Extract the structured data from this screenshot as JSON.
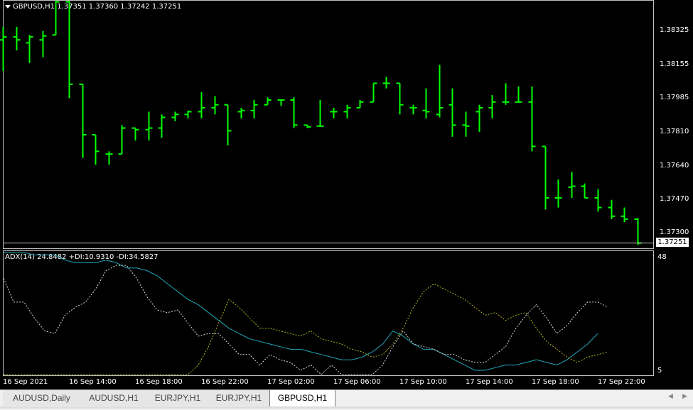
{
  "chart": {
    "symbol_title": "GBPUSD,H1  1.37351 1.37360 1.37242 1.37251",
    "current_price": "1.37251",
    "price_axis": [
      "1.38325",
      "1.38155",
      "1.37985",
      "1.37810",
      "1.37640",
      "1.37470",
      "1.37300"
    ],
    "bar_color": "#00ff00",
    "bars": [
      [
        1.38281,
        1.38347,
        1.38123,
        1.38296
      ],
      [
        1.38296,
        1.38347,
        1.38228,
        1.38281
      ],
      [
        1.38266,
        1.38306,
        1.38164,
        1.38296
      ],
      [
        1.38281,
        1.38326,
        1.38193,
        1.38301
      ],
      [
        1.38306,
        1.38479,
        1.38306,
        1.38474
      ],
      [
        1.38474,
        1.38479,
        1.37985,
        1.38056
      ],
      [
        1.38056,
        1.38056,
        1.37682,
        1.378
      ],
      [
        1.378,
        1.378,
        1.37648,
        1.37716
      ],
      [
        1.37702,
        1.37716,
        1.37648,
        1.37702
      ],
      [
        1.37702,
        1.37849,
        1.37702,
        1.37834
      ],
      [
        1.37834,
        1.37834,
        1.37771,
        1.37826
      ],
      [
        1.37826,
        1.37917,
        1.37771,
        1.37834
      ],
      [
        1.37834,
        1.37903,
        1.37785,
        1.37888
      ],
      [
        1.37888,
        1.37917,
        1.37869,
        1.37903
      ],
      [
        1.37903,
        1.37923,
        1.37883,
        1.37917
      ],
      [
        1.37917,
        1.38016,
        1.37883,
        1.37937
      ],
      [
        1.37937,
        1.37996,
        1.37903,
        1.37952
      ],
      [
        1.37952,
        1.37952,
        1.37746,
        1.3782
      ],
      [
        1.37917,
        1.37937,
        1.37883,
        1.37923
      ],
      [
        1.37923,
        1.37976,
        1.37883,
        1.37952
      ],
      [
        1.37952,
        1.3799,
        1.37952,
        1.37976
      ],
      [
        1.37976,
        1.37976,
        1.37947,
        1.37976
      ],
      [
        1.37976,
        1.3799,
        1.37834,
        1.37849
      ],
      [
        1.37849,
        1.37849,
        1.37834,
        1.3784
      ],
      [
        1.37844,
        1.37976,
        1.3784,
        1.37844
      ],
      [
        1.37917,
        1.37937,
        1.37883,
        1.37917
      ],
      [
        1.37917,
        1.37952,
        1.37883,
        1.37937
      ],
      [
        1.37937,
        1.37976,
        1.37937,
        1.37966
      ],
      [
        1.37966,
        1.38061,
        1.37966,
        1.38061
      ],
      [
        1.38061,
        1.38093,
        1.38035,
        1.38061
      ],
      [
        1.38061,
        1.38061,
        1.37903,
        1.37952
      ],
      [
        1.37937,
        1.37952,
        1.37903,
        1.37937
      ],
      [
        1.37923,
        1.38035,
        1.37883,
        1.37917
      ],
      [
        1.37903,
        1.38154,
        1.37888,
        1.37937
      ],
      [
        1.37952,
        1.38035,
        1.3779,
        1.37849
      ],
      [
        1.37849,
        1.37917,
        1.3779,
        1.37844
      ],
      [
        1.37917,
        1.37952,
        1.37815,
        1.37937
      ],
      [
        1.37937,
        1.38001,
        1.37883,
        1.37966
      ],
      [
        1.37966,
        1.38061,
        1.37952,
        1.37966
      ],
      [
        1.37966,
        1.38045,
        1.37966,
        1.37966
      ],
      [
        1.37966,
        1.38045,
        1.37716,
        1.37741
      ],
      [
        1.37741,
        1.37741,
        1.37421,
        1.3748
      ],
      [
        1.3748,
        1.37573,
        1.37431,
        1.3748
      ],
      [
        1.37534,
        1.37612,
        1.3748,
        1.37539
      ],
      [
        1.37539,
        1.37553,
        1.3748,
        1.3748
      ],
      [
        1.3748,
        1.37524,
        1.37411,
        1.37431
      ],
      [
        1.37431,
        1.3747,
        1.37372,
        1.37387
      ],
      [
        1.37387,
        1.37431,
        1.37357,
        1.37372
      ],
      [
        1.37372,
        1.37378,
        1.37242,
        1.37251
      ]
    ],
    "indicator": {
      "title": "ADX(14) 24.8482 +DI:10.9310 -DI:34.5827",
      "axis_top": "48",
      "axis_bottom": "5",
      "adx_color": "#1fa6b8",
      "plus_di_color": "#b5b521",
      "minus_di_color": "#d9d9d9",
      "adx": [
        52,
        52,
        50,
        49,
        49,
        49,
        47,
        46,
        46,
        46,
        47,
        46,
        44,
        44,
        43,
        41,
        38,
        35,
        32,
        30,
        27,
        24,
        21,
        19,
        17,
        16,
        15,
        14,
        13,
        13,
        12,
        11,
        10,
        9,
        9,
        10,
        12,
        15,
        20,
        18,
        15,
        13,
        13,
        11,
        9,
        7,
        5,
        5,
        6,
        7,
        7,
        8,
        9,
        8,
        7,
        9,
        12,
        15,
        19
      ],
      "plus_di": [
        -21,
        -22,
        -23,
        -24,
        -24,
        -24,
        -22,
        -14,
        -2,
        -3,
        -5,
        -6,
        -7,
        -8,
        -9,
        -10,
        -7,
        -2,
        2,
        7,
        14,
        23,
        32,
        29,
        25,
        21,
        21,
        20,
        19,
        18,
        20,
        17,
        16,
        15,
        13,
        12,
        10,
        11,
        15,
        21,
        29,
        35,
        38,
        36,
        34,
        32,
        29,
        26,
        27,
        24,
        26,
        27,
        21,
        16,
        13,
        10,
        8,
        10,
        11,
        12,
        10,
        9,
        6,
        4,
        2,
        0,
        -2,
        -4,
        -6
      ],
      "minus_di": [
        40,
        31,
        31,
        25,
        20,
        19,
        26,
        29,
        31,
        36,
        43,
        45,
        45,
        40,
        33,
        28,
        27,
        28,
        23,
        18,
        19,
        19,
        15,
        11,
        11,
        7,
        11,
        9,
        8,
        5,
        7,
        2,
        7,
        2,
        0,
        -5,
        -2,
        7,
        14,
        20,
        15,
        14,
        13,
        11,
        11,
        9,
        8,
        8,
        11,
        14,
        21,
        26,
        30,
        25,
        19,
        22,
        27,
        31,
        31,
        29,
        39
      ]
    },
    "time_axis": [
      "16 Sep 2021",
      "16 Sep 14:00",
      "16 Sep 18:00",
      "16 Sep 22:00",
      "17 Sep 02:00",
      "17 Sep 06:00",
      "17 Sep 10:00",
      "17 Sep 14:00",
      "17 Sep 18:00",
      "17 Sep 22:00"
    ]
  },
  "tabs": [
    {
      "label": "AUDUSD,Daily",
      "active": false
    },
    {
      "label": "AUDUSD,H1",
      "active": false
    },
    {
      "label": "EURJPY,H1",
      "active": false
    },
    {
      "label": "EURJPY,H1",
      "active": false
    },
    {
      "label": "GBPUSD,H1",
      "active": true
    }
  ],
  "scroll": {
    "left": "◀",
    "right": "▶"
  }
}
